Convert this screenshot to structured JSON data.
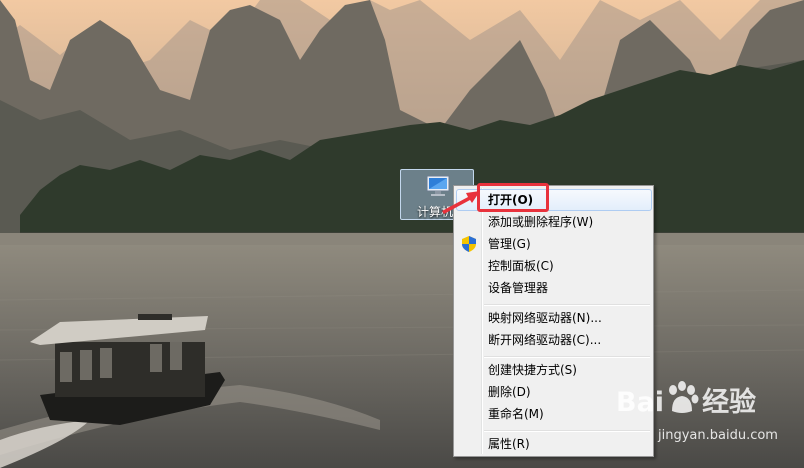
{
  "desktop": {
    "icon_label": "计算机"
  },
  "context_menu": {
    "items": [
      {
        "label": "打开(O)",
        "highlighted": true
      },
      {
        "label": "添加或删除程序(W)"
      },
      {
        "label": "管理(G)",
        "icon": "uac-shield-icon"
      },
      {
        "label": "控制面板(C)"
      },
      {
        "label": "设备管理器"
      },
      {
        "label": "映射网络驱动器(N)..."
      },
      {
        "label": "断开网络驱动器(C)..."
      },
      {
        "label": "创建快捷方式(S)"
      },
      {
        "label": "删除(D)"
      },
      {
        "label": "重命名(M)"
      },
      {
        "label": "属性(R)"
      }
    ]
  },
  "watermark": {
    "brand_left": "Bai",
    "brand_right": "经验",
    "url": "jingyan.baidu.com"
  },
  "colors": {
    "annotation": "#e8323c",
    "menu_background": "#f0f0f0",
    "highlight_border": "#aeccf2"
  }
}
